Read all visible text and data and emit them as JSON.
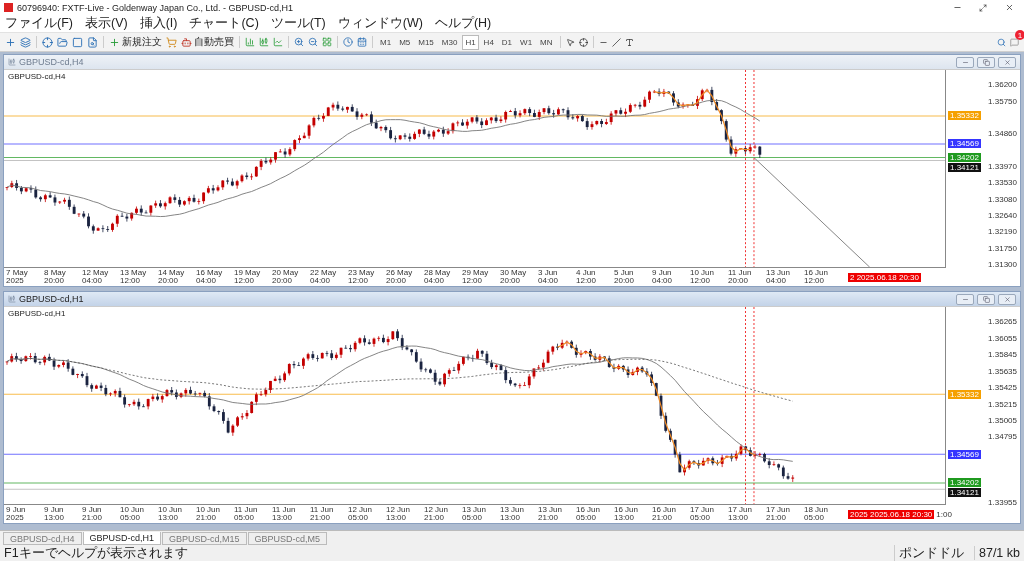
{
  "window": {
    "title": "60796940: FXTF-Live - Goldenway Japan Co., Ltd. - GBPUSD-cd,H1"
  },
  "menu": [
    "ファイル(F)",
    "表示(V)",
    "挿入(I)",
    "チャート(C)",
    "ツール(T)",
    "ウィンドウ(W)",
    "ヘルプ(H)"
  ],
  "toolbar": {
    "labeled_buttons": [
      "新規注文",
      "自動売買"
    ],
    "timeframes": [
      {
        "label": "M1",
        "selected": false
      },
      {
        "label": "M5",
        "selected": false
      },
      {
        "label": "M15",
        "selected": false
      },
      {
        "label": "M30",
        "selected": false
      },
      {
        "label": "H1",
        "selected": true
      },
      {
        "label": "H4",
        "selected": false
      },
      {
        "label": "D1",
        "selected": false
      },
      {
        "label": "W1",
        "selected": false
      },
      {
        "label": "MN",
        "selected": false
      }
    ],
    "notification_count": "1"
  },
  "charts": [
    {
      "window_title": "GBPUSD-cd,H4",
      "active": false,
      "label": "GBPUSD-cd,H4",
      "y_labels": [
        "1.36200",
        "1.35750",
        "1.34860",
        "1.33970",
        "1.33530",
        "1.33080",
        "1.32640",
        "1.32190",
        "1.31750",
        "1.31300"
      ],
      "price_tags": [
        {
          "text": "1.35332",
          "color": "#f5a000"
        },
        {
          "text": "1.34569",
          "color": "#3535ff"
        },
        {
          "text": "1.34202",
          "color": "#1f9a1f"
        },
        {
          "text": "1.34121",
          "color": "#111111"
        }
      ],
      "x_labels": [
        "7 May 2025",
        "8 May 20:00",
        "12 May 04:00",
        "13 May 12:00",
        "14 May 20:00",
        "16 May 04:00",
        "19 May 12:00",
        "20 May 20:00",
        "22 May 04:00",
        "23 May 12:00",
        "26 May 20:00",
        "28 May 04:00",
        "29 May 12:00",
        "30 May 20:00",
        "3 Jun 04:00",
        "4 Jun 12:00",
        "5 Jun 20:00",
        "9 Jun 04:00",
        "10 Jun 12:00",
        "11 Jun 20:00",
        "13 Jun 04:00",
        "16 Jun 12:00"
      ],
      "time_marker": "2 2025.06.18 20:30"
    },
    {
      "window_title": "GBPUSD-cd,H1",
      "active": true,
      "label": "GBPUSD-cd,H1",
      "y_labels": [
        "1.36265",
        "1.36055",
        "1.35845",
        "1.35635",
        "1.35425",
        "1.35215",
        "1.35005",
        "1.34795",
        "1.33955"
      ],
      "price_tags": [
        {
          "text": "1.35332",
          "color": "#f5a000"
        },
        {
          "text": "1.34569",
          "color": "#3535ff"
        },
        {
          "text": "1.34202",
          "color": "#1f9a1f"
        },
        {
          "text": "1.34121",
          "color": "#111111"
        }
      ],
      "x_labels": [
        "9 Jun 2025",
        "9 Jun 13:00",
        "9 Jun 21:00",
        "10 Jun 05:00",
        "10 Jun 13:00",
        "10 Jun 21:00",
        "11 Jun 05:00",
        "11 Jun 13:00",
        "11 Jun 21:00",
        "12 Jun 05:00",
        "12 Jun 13:00",
        "12 Jun 21:00",
        "13 Jun 05:00",
        "13 Jun 13:00",
        "13 Jun 21:00",
        "16 Jun 05:00",
        "16 Jun 13:00",
        "16 Jun 21:00",
        "17 Jun 05:00",
        "17 Jun 13:00",
        "17 Jun 21:00",
        "18 Jun 05:00"
      ],
      "time_marker": "2025 2025.06.18 20:30",
      "x_tail": "1:00"
    }
  ],
  "tabs": [
    {
      "label": "GBPUSD-cd,H4",
      "selected": false
    },
    {
      "label": "GBPUSD-cd,H1",
      "selected": true
    },
    {
      "label": "GBPUSD-cd,M15",
      "selected": false
    },
    {
      "label": "GBPUSD-cd,M5",
      "selected": false
    }
  ],
  "status_bar": {
    "help": "F1キーでヘルプが表示されます",
    "symbol": "ポンドドル",
    "traffic": "87/1 kb"
  }
}
